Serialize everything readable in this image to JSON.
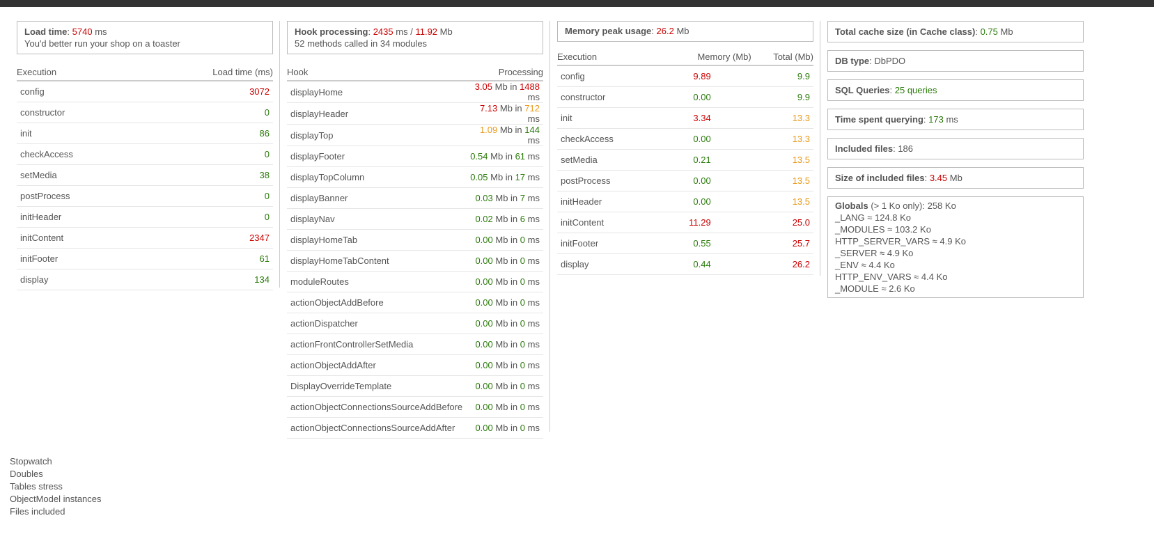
{
  "load": {
    "label": "Load time",
    "value": "5740",
    "unit": "ms",
    "note": "You'd better run your shop on a toaster",
    "headers": [
      "Execution",
      "Load time (ms)"
    ],
    "rows": [
      {
        "name": "config",
        "value": "3072",
        "color": "#cc0000"
      },
      {
        "name": "constructor",
        "value": "0",
        "color": "#2b7a0b"
      },
      {
        "name": "init",
        "value": "86",
        "color": "#2b7a0b"
      },
      {
        "name": "checkAccess",
        "value": "0",
        "color": "#2b7a0b"
      },
      {
        "name": "setMedia",
        "value": "38",
        "color": "#2b7a0b"
      },
      {
        "name": "postProcess",
        "value": "0",
        "color": "#2b7a0b"
      },
      {
        "name": "initHeader",
        "value": "0",
        "color": "#2b7a0b"
      },
      {
        "name": "initContent",
        "value": "2347",
        "color": "#cc0000"
      },
      {
        "name": "initFooter",
        "value": "61",
        "color": "#2b7a0b"
      },
      {
        "name": "display",
        "value": "134",
        "color": "#2b7a0b"
      }
    ]
  },
  "hooks": {
    "label": "Hook processing",
    "ms": "2435",
    "ms_unit": "ms",
    "slash": "/",
    "mb": "11.92",
    "mb_unit": "Mb",
    "note": "52 methods called in 34 modules",
    "headers": [
      "Hook",
      "Processing"
    ],
    "mb_word": "Mb in",
    "ms_word": "ms",
    "rows": [
      {
        "name": "displayHome",
        "mb": "3.05",
        "mb_color": "#cc0000",
        "ms": "1488",
        "ms_color": "#cc0000"
      },
      {
        "name": "displayHeader",
        "mb": "7.13",
        "mb_color": "#cc0000",
        "ms": "712",
        "ms_color": "#e89a1a"
      },
      {
        "name": "displayTop",
        "mb": "1.09",
        "mb_color": "#e89a1a",
        "ms": "144",
        "ms_color": "#2b7a0b"
      },
      {
        "name": "displayFooter",
        "mb": "0.54",
        "mb_color": "#2b7a0b",
        "ms": "61",
        "ms_color": "#2b7a0b"
      },
      {
        "name": "displayTopColumn",
        "mb": "0.05",
        "mb_color": "#2b7a0b",
        "ms": "17",
        "ms_color": "#2b7a0b"
      },
      {
        "name": "displayBanner",
        "mb": "0.03",
        "mb_color": "#2b7a0b",
        "ms": "7",
        "ms_color": "#2b7a0b"
      },
      {
        "name": "displayNav",
        "mb": "0.02",
        "mb_color": "#2b7a0b",
        "ms": "6",
        "ms_color": "#2b7a0b"
      },
      {
        "name": "displayHomeTab",
        "mb": "0.00",
        "mb_color": "#2b7a0b",
        "ms": "0",
        "ms_color": "#2b7a0b"
      },
      {
        "name": "displayHomeTabContent",
        "mb": "0.00",
        "mb_color": "#2b7a0b",
        "ms": "0",
        "ms_color": "#2b7a0b"
      },
      {
        "name": "moduleRoutes",
        "mb": "0.00",
        "mb_color": "#2b7a0b",
        "ms": "0",
        "ms_color": "#2b7a0b"
      },
      {
        "name": "actionObjectAddBefore",
        "mb": "0.00",
        "mb_color": "#2b7a0b",
        "ms": "0",
        "ms_color": "#2b7a0b"
      },
      {
        "name": "actionDispatcher",
        "mb": "0.00",
        "mb_color": "#2b7a0b",
        "ms": "0",
        "ms_color": "#2b7a0b"
      },
      {
        "name": "actionFrontControllerSetMedia",
        "mb": "0.00",
        "mb_color": "#2b7a0b",
        "ms": "0",
        "ms_color": "#2b7a0b"
      },
      {
        "name": "actionObjectAddAfter",
        "mb": "0.00",
        "mb_color": "#2b7a0b",
        "ms": "0",
        "ms_color": "#2b7a0b"
      },
      {
        "name": "DisplayOverrideTemplate",
        "mb": "0.00",
        "mb_color": "#2b7a0b",
        "ms": "0",
        "ms_color": "#2b7a0b"
      },
      {
        "name": "actionObjectConnectionsSourceAddBefore",
        "mb": "0.00",
        "mb_color": "#2b7a0b",
        "ms": "0",
        "ms_color": "#2b7a0b"
      },
      {
        "name": "actionObjectConnectionsSourceAddAfter",
        "mb": "0.00",
        "mb_color": "#2b7a0b",
        "ms": "0",
        "ms_color": "#2b7a0b"
      }
    ]
  },
  "memory": {
    "label": "Memory peak usage",
    "value": "26.2",
    "unit": "Mb",
    "headers": [
      "Execution",
      "Memory (Mb)",
      "Total (Mb)"
    ],
    "rows": [
      {
        "name": "config",
        "mem": "9.89",
        "mem_color": "#cc0000",
        "total": "9.9",
        "total_color": "#2b7a0b"
      },
      {
        "name": "constructor",
        "mem": "0.00",
        "mem_color": "#2b7a0b",
        "total": "9.9",
        "total_color": "#2b7a0b"
      },
      {
        "name": "init",
        "mem": "3.34",
        "mem_color": "#cc0000",
        "total": "13.3",
        "total_color": "#e89a1a"
      },
      {
        "name": "checkAccess",
        "mem": "0.00",
        "mem_color": "#2b7a0b",
        "total": "13.3",
        "total_color": "#e89a1a"
      },
      {
        "name": "setMedia",
        "mem": "0.21",
        "mem_color": "#2b7a0b",
        "total": "13.5",
        "total_color": "#e89a1a"
      },
      {
        "name": "postProcess",
        "mem": "0.00",
        "mem_color": "#2b7a0b",
        "total": "13.5",
        "total_color": "#e89a1a"
      },
      {
        "name": "initHeader",
        "mem": "0.00",
        "mem_color": "#2b7a0b",
        "total": "13.5",
        "total_color": "#e89a1a"
      },
      {
        "name": "initContent",
        "mem": "11.29",
        "mem_color": "#cc0000",
        "total": "25.0",
        "total_color": "#cc0000"
      },
      {
        "name": "initFooter",
        "mem": "0.55",
        "mem_color": "#2b7a0b",
        "total": "25.7",
        "total_color": "#cc0000"
      },
      {
        "name": "display",
        "mem": "0.44",
        "mem_color": "#2b7a0b",
        "total": "26.2",
        "total_color": "#cc0000"
      }
    ]
  },
  "summary": {
    "cache": {
      "label": "Total cache size (in Cache class)",
      "value": "0.75",
      "unit": "Mb"
    },
    "db": {
      "label": "DB type",
      "value": "DbPDO"
    },
    "sql": {
      "label": "SQL Queries",
      "value": "25 queries"
    },
    "query_time": {
      "label": "Time spent querying",
      "value": "173",
      "unit": "ms"
    },
    "included": {
      "label": "Included files",
      "value": "186"
    },
    "included_size": {
      "label": "Size of included files",
      "value": "3.45",
      "unit": "Mb"
    },
    "globals": {
      "label": "Globals",
      "note": "(> 1 Ko only): 258 Ko",
      "items": [
        "_LANG ≈ 124.8 Ko",
        "_MODULES ≈ 103.2 Ko",
        "HTTP_SERVER_VARS ≈ 4.9 Ko",
        "_SERVER ≈ 4.9 Ko",
        "_ENV ≈ 4.4 Ko",
        "HTTP_ENV_VARS ≈ 4.4 Ko",
        "_MODULE ≈ 2.6 Ko"
      ]
    }
  },
  "links": [
    "Stopwatch",
    "Doubles",
    "Tables stress",
    "ObjectModel instances",
    "Files included"
  ],
  "colors": {
    "red": "#cc0000",
    "green": "#2b7a0b",
    "orange": "#e89a1a",
    "topbar": "#333333"
  }
}
